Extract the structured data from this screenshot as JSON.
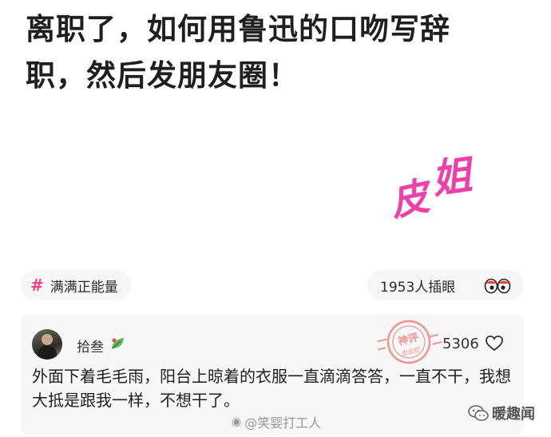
{
  "post": {
    "title_line1": "离职了，如何用鲁迅的口吻写辞",
    "title_line2": "职，然后发朋友圈！"
  },
  "watermark": {
    "char1": "皮",
    "char2": "姐",
    "color": "#ef3fa8"
  },
  "topic": {
    "label": "满满正能量",
    "icon": "hash-icon"
  },
  "viewers": {
    "text": "1953人插眼",
    "icon": "eyes-icon"
  },
  "comment": {
    "username": "拾叁",
    "badge_icon": "leaf-icon",
    "stamp_text": "神评",
    "stamp_subtext": "皮皮虾",
    "likes": "5306",
    "like_icon": "heart-hands-icon",
    "text": "外面下着毛毛雨，阳台上晾着的衣服一直滴滴答答，一直不干，我想大抵是跟我一样，不想干了。"
  },
  "footer": {
    "weibo_watermark": "@笑婴打工人",
    "source_name": "暖趣闻",
    "source_icon": "wechat-icon"
  },
  "colors": {
    "accent_pink": "#f0408a",
    "stamp_red": "#e8443a",
    "card_bg": "#f7f7f7"
  }
}
